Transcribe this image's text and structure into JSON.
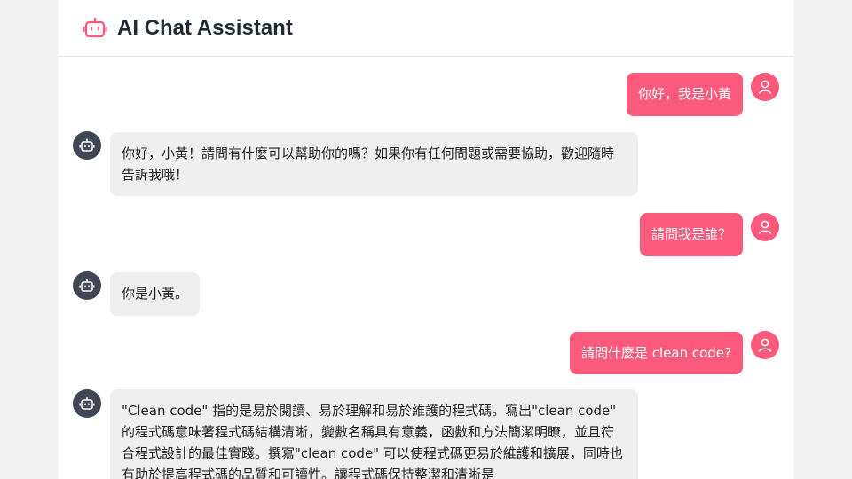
{
  "app": {
    "title": "AI Chat Assistant",
    "logo_icon": "robot-icon",
    "accent_color": "#fb5a7c"
  },
  "messages": [
    {
      "role": "user",
      "avatar_icon": "user-icon",
      "text": "你好，我是小黃"
    },
    {
      "role": "assistant",
      "avatar_icon": "robot-icon",
      "text": "你好，小黃！請問有什麼可以幫助你的嗎？如果你有任何問題或需要協助，歡迎隨時告訴我哦！"
    },
    {
      "role": "user",
      "avatar_icon": "user-icon",
      "text": "請問我是誰？"
    },
    {
      "role": "assistant",
      "avatar_icon": "robot-icon",
      "text": "你是小黃。"
    },
    {
      "role": "user",
      "avatar_icon": "user-icon",
      "text": "請問什麼是 clean code?"
    },
    {
      "role": "assistant",
      "avatar_icon": "robot-icon",
      "text": "\"Clean code\" 指的是易於閱讀、易於理解和易於維護的程式碼。寫出\"clean code\" 的程式碼意味著程式碼結構清晰，變數名稱具有意義，函數和方法簡潔明瞭，並且符合程式設計的最佳實踐。撰寫\"clean code\" 可以使程式碼更易於維護和擴展，同時也有助於提高程式碼的品質和可讀性。讓程式碼保持整潔和清晰是"
    }
  ]
}
